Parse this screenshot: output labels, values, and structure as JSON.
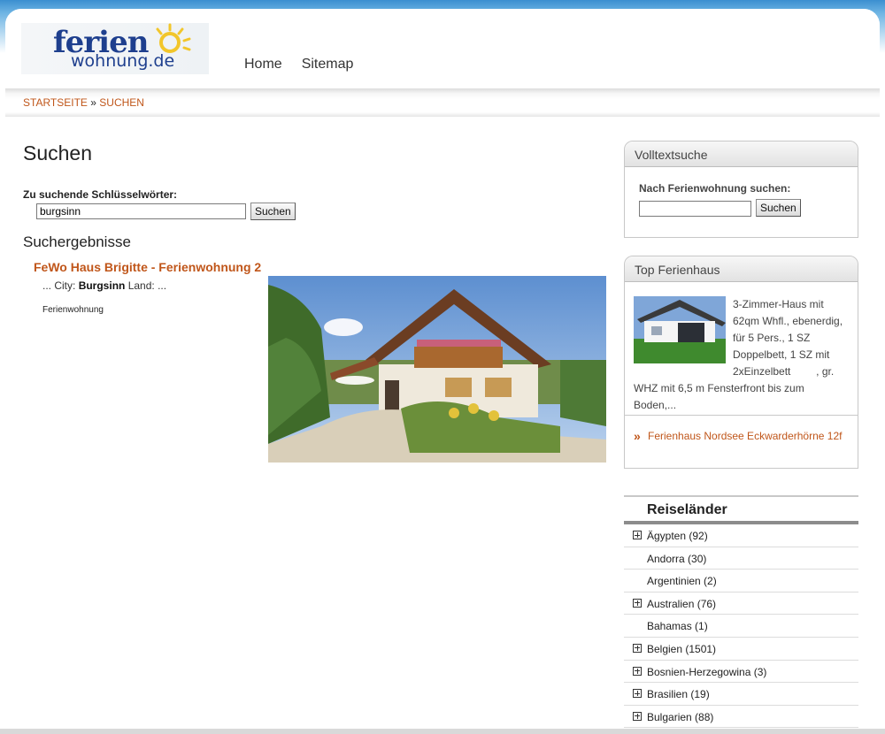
{
  "brand": {
    "logo_top": "ferien",
    "logo_bottom": "wohnung.de"
  },
  "nav": [
    {
      "label": "Home"
    },
    {
      "label": "Sitemap"
    }
  ],
  "breadcrumb": {
    "home": "Startseite",
    "sep": "»",
    "current": "Suchen"
  },
  "main": {
    "title": "Suchen",
    "keyword_label": "Zu suchende Schlüsselwörter:",
    "keyword_value": "burgsinn",
    "search_button": "Suchen",
    "results_title": "Suchergebnisse",
    "result": {
      "title": "FeWo Haus Brigitte - Ferienwohnung 2",
      "snippet_prefix": "... City:",
      "snippet_city": "Burgsinn",
      "snippet_suffix": "Land:  ...",
      "category": "Ferienwohnung"
    }
  },
  "sidebar": {
    "volltext": {
      "title": "Volltextsuche",
      "label": "Nach Ferienwohnung suchen:",
      "value": "",
      "button": "Suchen"
    },
    "top": {
      "title": "Top Ferienhaus",
      "description": "3-Zimmer-Haus mit 62qm Whfl., ebenerdig, für 5 Pers., 1 SZ Doppelbett, 1 SZ mit 2xEinzelbett, gr. WHZ mit 6,5 m Fensterfront bis zum Boden,...",
      "link": "Ferienhaus Nordsee Eckwarderhörne 12f"
    },
    "countries": {
      "title": "Reiseländer",
      "items": [
        {
          "label": "Ägypten (92)",
          "expandable": true
        },
        {
          "label": "Andorra (30)",
          "expandable": false
        },
        {
          "label": "Argentinien (2)",
          "expandable": false
        },
        {
          "label": "Australien (76)",
          "expandable": true
        },
        {
          "label": "Bahamas (1)",
          "expandable": false
        },
        {
          "label": "Belgien (1501)",
          "expandable": true
        },
        {
          "label": "Bosnien-Herzegowina (3)",
          "expandable": true
        },
        {
          "label": "Brasilien (19)",
          "expandable": true
        },
        {
          "label": "Bulgarien (88)",
          "expandable": true
        }
      ]
    }
  },
  "colors": {
    "accent": "#c0561a",
    "brand_blue": "#1e3f8e",
    "sun": "#f2c62b"
  }
}
